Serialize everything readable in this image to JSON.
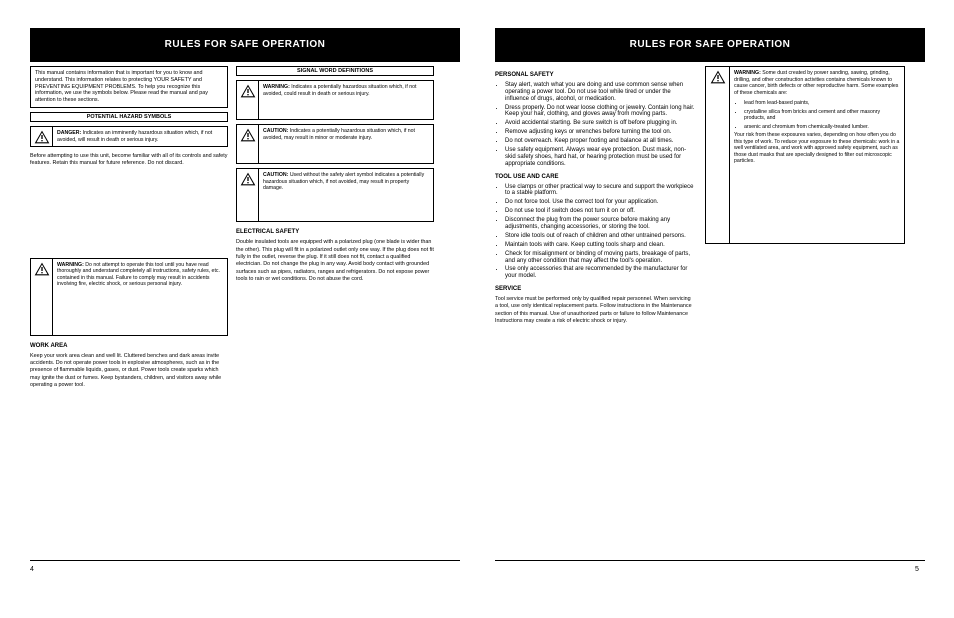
{
  "left": {
    "title": "RULES FOR SAFE OPERATION",
    "intro_box": "This manual contains information that is important for you to know and understand. This information relates to protecting YOUR SAFETY and PREVENTING EQUIPMENT PROBLEMS. To help you recognize this information, we use the symbols below. Please read the manual and pay attention to these sections.",
    "danger_banner": "POTENTIAL HAZARD SYMBOLS",
    "danger_box": {
      "label": "DANGER:",
      "text": "Indicates an imminently hazardous situation which, if not avoided, will result in death or serious injury."
    },
    "col2_banner": "SIGNAL WORD DEFINITIONS",
    "w1": {
      "label": "WARNING:",
      "text": "Indicates a potentially hazardous situation which, if not avoided, could result in death or serious injury."
    },
    "w2": {
      "label": "CAUTION:",
      "text": "Indicates a potentially hazardous situation which, if not avoided, may result in minor or moderate injury."
    },
    "w3": {
      "label": "CAUTION:",
      "text": "Used without the safety alert symbol indicates a potentially hazardous situation which, if not avoided, may result in property damage."
    },
    "para1": "Before attempting to use this unit, become familiar with all of its controls and safety features. Retain this manual for future reference. Do not discard.",
    "big_warn": {
      "label": "WARNING:",
      "text": "Do not attempt to operate this tool until you have read thoroughly and understand completely all instructions, safety rules, etc. contained in this manual. Failure to comply may result in accidents involving fire, electric shock, or serious personal injury."
    },
    "h_workarea": "WORK AREA",
    "workarea": "Keep your work area clean and well lit. Cluttered benches and dark areas invite accidents. Do not operate power tools in explosive atmospheres, such as in the presence of flammable liquids, gases, or dust. Power tools create sparks which may ignite the dust or fumes. Keep bystanders, children, and visitors away while operating a power tool.",
    "h_elec": "ELECTRICAL SAFETY",
    "elec": "Double insulated tools are equipped with a polarized plug (one blade is wider than the other). This plug will fit in a polarized outlet only one way. If the plug does not fit fully in the outlet, reverse the plug. If it still does not fit, contact a qualified electrician. Do not change the plug in any way. Avoid body contact with grounded surfaces such as pipes, radiators, ranges and refrigerators. Do not expose power tools to rain or wet conditions. Do not abuse the cord.",
    "pg": "4"
  },
  "right": {
    "title": "RULES FOR SAFE OPERATION",
    "h_personal": "PERSONAL SAFETY",
    "personal_items": [
      "Stay alert, watch what you are doing and use common sense when operating a power tool. Do not use tool while tired or under the influence of drugs, alcohol, or medication.",
      "Dress properly. Do not wear loose clothing or jewelry. Contain long hair. Keep your hair, clothing, and gloves away from moving parts.",
      "Avoid accidental starting. Be sure switch is off before plugging in.",
      "Remove adjusting keys or wrenches before turning the tool on.",
      "Do not overreach. Keep proper footing and balance at all times.",
      "Use safety equipment. Always wear eye protection. Dust mask, non-skid safety shoes, hard hat, or hearing protection must be used for appropriate conditions."
    ],
    "h_tooluse": "TOOL USE AND CARE",
    "tooluse_items": [
      "Use clamps or other practical way to secure and support the workpiece to a stable platform.",
      "Do not force tool. Use the correct tool for your application.",
      "Do not use tool if switch does not turn it on or off.",
      "Disconnect the plug from the power source before making any adjustments, changing accessories, or storing the tool.",
      "Store idle tools out of reach of children and other untrained persons.",
      "Maintain tools with care. Keep cutting tools sharp and clean.",
      "Check for misalignment or binding of moving parts, breakage of parts, and any other condition that may affect the tool's operation.",
      "Use only accessories that are recommended by the manufacturer for your model."
    ],
    "h_service": "SERVICE",
    "service": "Tool service must be performed only by qualified repair personnel. When servicing a tool, use only identical replacement parts. Follow instructions in the Maintenance section of this manual. Use of unauthorized parts or failure to follow Maintenance Instructions may create a risk of electric shock or injury.",
    "big_warn": {
      "label": "WARNING:",
      "text1": "Some dust created by power sanding, sawing, grinding, drilling, and other construction activities contains chemicals known to cause cancer, birth defects or other reproductive harm. Some examples of these chemicals are:",
      "bullets": [
        "lead from lead-based paints,",
        "crystalline silica from bricks and cement and other masonry products, and",
        "arsenic and chromium from chemically-treated lumber."
      ],
      "text2": "Your risk from these exposures varies, depending on how often you do this type of work. To reduce your exposure to these chemicals: work in a well ventilated area, and work with approved safety equipment, such as those dust masks that are specially designed to filter out microscopic particles."
    },
    "pg": "5"
  }
}
